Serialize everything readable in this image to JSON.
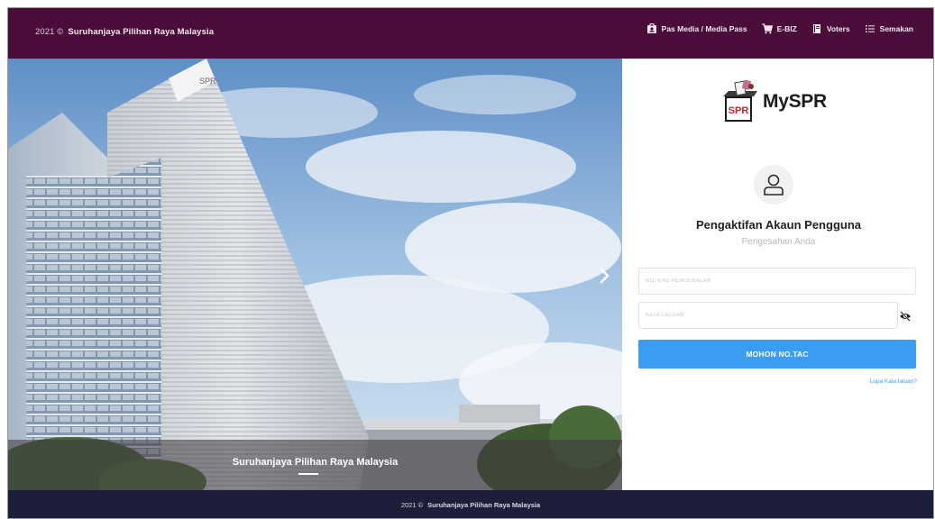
{
  "header": {
    "year": "2021 ©",
    "brand": "Suruhanjaya Pilihan Raya Malaysia",
    "nav": [
      {
        "label": "Pas Media / Media Pass",
        "icon": "id-card-icon"
      },
      {
        "label": "E-BIZ",
        "icon": "cart-icon"
      },
      {
        "label": "Voters",
        "icon": "book-icon"
      },
      {
        "label": "Semakan",
        "icon": "list-icon"
      }
    ]
  },
  "hero": {
    "caption": "Suruhanjaya Pilihan Raya Malaysia",
    "building_sign": "SPR"
  },
  "login": {
    "logo_text": "MySPR",
    "logo_badge": "SPR",
    "title": "Pengaktifan Akaun Pengguna",
    "subtitle": "Pengesahan Anda",
    "ic_placeholder": "NO. KAD PENGENALAN",
    "password_placeholder": "KATA LALUAN",
    "submit_label": "MOHON NO.TAC",
    "forgot_label": "Lupa Kata laluan?"
  },
  "footer": {
    "year": "2021 ©",
    "text": "Suruhanjaya Pilihan Raya Malaysia"
  },
  "colors": {
    "header_bg": "#4a0d3a",
    "footer_bg": "#1d1f3a",
    "accent": "#3a9df2"
  }
}
